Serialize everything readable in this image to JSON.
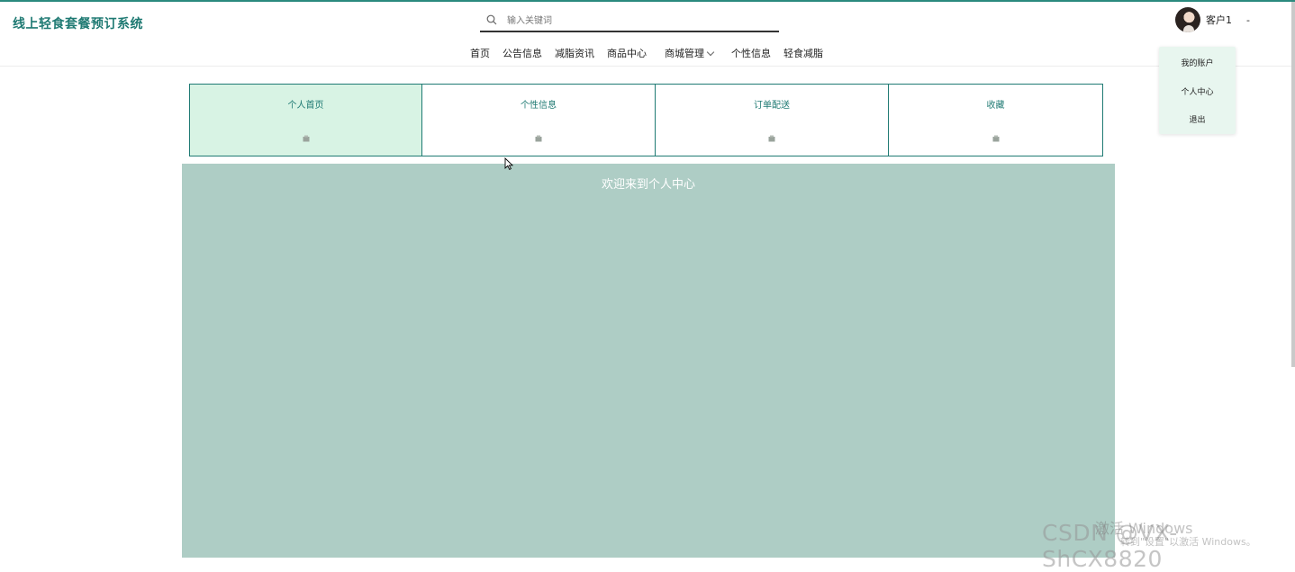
{
  "header": {
    "brand": "线上轻食套餐预订系统",
    "search_placeholder": "输入关键词",
    "nav": [
      "首页",
      "公告信息",
      "减脂资讯",
      "商品中心",
      "商城管理",
      "个性信息",
      "轻食减脂"
    ],
    "user_name": "客户1",
    "user_dash": "-"
  },
  "user_menu": [
    "我的账户",
    "个人中心",
    "退出"
  ],
  "tabs": [
    {
      "label": "个人首页",
      "active": true
    },
    {
      "label": "个性信息",
      "active": false
    },
    {
      "label": "订单配送",
      "active": false
    },
    {
      "label": "收藏",
      "active": false
    }
  ],
  "panel": {
    "title": "欢迎来到个人中心"
  },
  "watermark": {
    "activate_line1": "激活 Windows",
    "activate_line2": "转到\"设置\"以激活 Windows。",
    "csdn": "CSDN @VX-ShCX8820"
  },
  "colors": {
    "accent": "#1f7a73",
    "tab_active": "#d8f3e4",
    "panel": "#aecdc5"
  }
}
